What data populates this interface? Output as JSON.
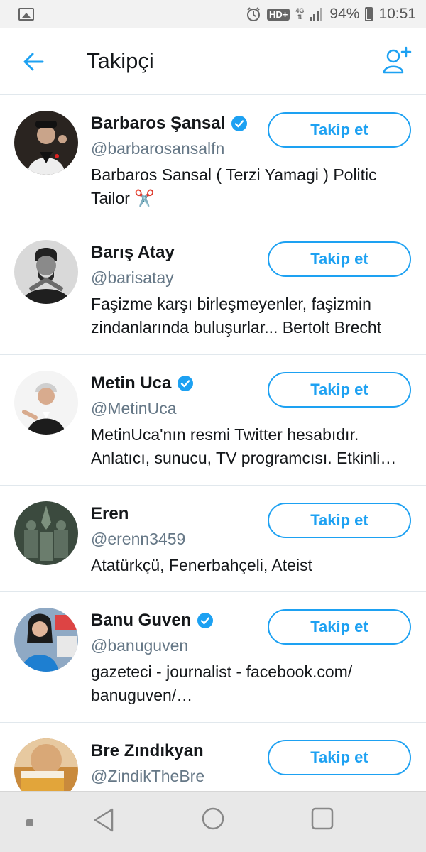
{
  "status_bar": {
    "hd_label": "HD+",
    "network_top": "4G",
    "network_bottom": "⇅",
    "battery": "94%",
    "time": "10:51"
  },
  "header": {
    "title": "Takipçi"
  },
  "colors": {
    "accent": "#1da1f2",
    "text": "#14171a",
    "muted": "#657786",
    "divider": "#e1e8ed"
  },
  "followers": [
    {
      "name": "Barbaros Şansal",
      "verified": true,
      "handle": "@barbarosansalfn",
      "bio": "Barbaros Sansal ( Terzi Yamagi ) Politic Tailor ✂️",
      "button": "Takip et"
    },
    {
      "name": "Barış Atay",
      "verified": false,
      "handle": "@barisatay",
      "bio": "Faşizme karşı birleşmeyenler, faşizmin zindanlarında buluşurlar... Bertolt Brecht",
      "button": "Takip et"
    },
    {
      "name": "Metin Uca",
      "verified": true,
      "handle": "@MetinUca",
      "bio_line1": "MetinUca'nın resmi Twitter hesabıdır.",
      "bio_line2": "Anlatıcı, sunucu, TV programcısı. Etkinli…",
      "button": "Takip et"
    },
    {
      "name": "Eren",
      "verified": false,
      "handle": "@erenn3459",
      "bio": "Atatürkçü, Fenerbahçeli, Ateist",
      "button": "Takip et"
    },
    {
      "name": "Banu Guven",
      "verified": true,
      "handle": "@banuguven",
      "bio_line1": "gazeteci - journalist - facebook.com/",
      "bio_line2": "banuguven/…",
      "button": "Takip et"
    },
    {
      "name": "Bre Zındıkyan",
      "verified": false,
      "handle": "@ZindikTheBre",
      "button": "Takip et"
    }
  ]
}
